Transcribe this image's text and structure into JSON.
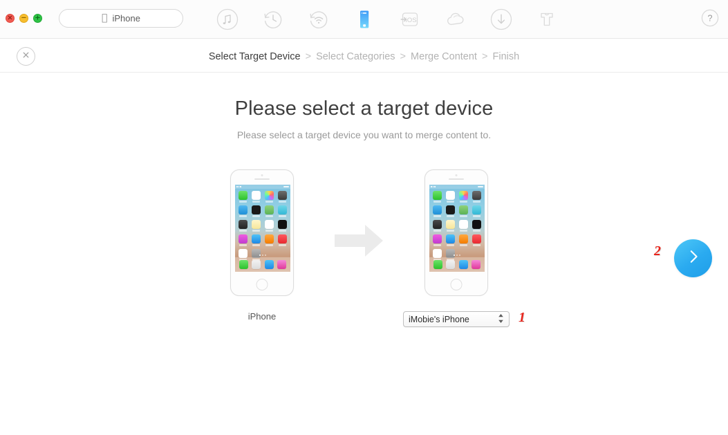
{
  "window": {
    "traffic_lights": [
      {
        "name": "close",
        "glyph": "×",
        "color": "#f05b52"
      },
      {
        "name": "minimize",
        "glyph": "−",
        "color": "#f7bd2e"
      },
      {
        "name": "maximize",
        "glyph": "+",
        "color": "#2fc246"
      }
    ],
    "device_pill": {
      "label": "iPhone",
      "icon": "apple-logo-icon"
    }
  },
  "toolbar": {
    "items": [
      {
        "id": "music",
        "icon": "music-note-circle-icon",
        "label": "Music",
        "selected": false
      },
      {
        "id": "backup-restore",
        "icon": "clock-rewind-circle-icon",
        "label": "Backup Restore",
        "selected": false
      },
      {
        "id": "airdrop",
        "icon": "wifi-rewind-circle-icon",
        "label": "AirDrop",
        "selected": false
      },
      {
        "id": "device-manager",
        "icon": "phone-icon",
        "label": "Device Manager",
        "selected": true
      },
      {
        "id": "to-ios",
        "icon": "to-ios-icon",
        "label": "iOS Mover",
        "selected": false
      },
      {
        "id": "icloud",
        "icon": "cloud-icon",
        "label": "iCloud",
        "selected": false
      },
      {
        "id": "downloader",
        "icon": "download-circle-icon",
        "label": "Downloader",
        "selected": false
      },
      {
        "id": "cleaner",
        "icon": "shirt-icon",
        "label": "Cleaner",
        "selected": false
      }
    ],
    "help": {
      "icon": "help-circle-icon",
      "label": "?"
    }
  },
  "wizard": {
    "close_icon": "close-x-icon",
    "breadcrumb": {
      "separator": ">",
      "steps": [
        {
          "label": "Select Target Device",
          "active": true
        },
        {
          "label": "Select Categories",
          "active": false
        },
        {
          "label": "Merge Content",
          "active": false
        },
        {
          "label": "Finish",
          "active": false
        }
      ]
    }
  },
  "main": {
    "title": "Please select a target device",
    "subtitle": "Please select a target device you want to merge content to.",
    "source_device": {
      "caption": "iPhone",
      "icon": "iphone-illustration"
    },
    "target_device": {
      "icon": "iphone-illustration"
    },
    "merge_arrow_icon": "arrow-right-icon",
    "device_select": {
      "value": "iMobie's iPhone",
      "options": [
        "iMobie's iPhone"
      ],
      "stepper_icon": "up-down-stepper-icon"
    },
    "next_button": {
      "label": "Next",
      "icon": "chevron-right-icon",
      "color": "#2aaaf0"
    },
    "annotations": [
      {
        "id": "anno-1",
        "label": "1"
      },
      {
        "id": "anno-2",
        "label": "2"
      }
    ]
  },
  "phone_screen": {
    "apps": [
      {
        "name": "messages",
        "color": "linear-gradient(#6ee26a,#2cc22c)"
      },
      {
        "name": "calendar",
        "color": "#ffffff"
      },
      {
        "name": "photos",
        "color": "#fafafa"
      },
      {
        "name": "camera",
        "color": "linear-gradient(#6d6d6d,#3a3a3a)"
      },
      {
        "name": "weather",
        "color": "linear-gradient(#4fb8f0,#1f8fd8)"
      },
      {
        "name": "clock",
        "color": "#1a1a1a"
      },
      {
        "name": "maps",
        "color": "linear-gradient(#8fd27a,#5bb356)"
      },
      {
        "name": "videos",
        "color": "linear-gradient(#6fd6e8,#33b9d6)"
      },
      {
        "name": "wallet",
        "color": "linear-gradient(#4a4a4a,#222222)"
      },
      {
        "name": "notes",
        "color": "linear-gradient(#fff6cc,#f7e79a)"
      },
      {
        "name": "reminders",
        "color": "#ffffff"
      },
      {
        "name": "stocks",
        "color": "#111111"
      },
      {
        "name": "itunes-store",
        "color": "linear-gradient(#f05ce0,#c13ad0)"
      },
      {
        "name": "app-store",
        "color": "linear-gradient(#4fc3f7,#1e88e5)"
      },
      {
        "name": "ibooks",
        "color": "linear-gradient(#ffa940,#f57c00)"
      },
      {
        "name": "news",
        "color": "linear-gradient(#ff5a5f,#e8282f)"
      },
      {
        "name": "health",
        "color": "#ffffff"
      },
      {
        "name": "settings",
        "color": "linear-gradient(#b8b8b8,#8c8c8c)"
      }
    ],
    "dock": [
      {
        "name": "phone",
        "color": "linear-gradient(#6ee26a,#2cc22c)"
      },
      {
        "name": "safari",
        "color": "linear-gradient(#f2f2f2,#dcdcdc)"
      },
      {
        "name": "mail",
        "color": "linear-gradient(#4fc3f7,#1e88e5)"
      },
      {
        "name": "music",
        "color": "linear-gradient(#f587d8,#e0399a)"
      }
    ]
  }
}
